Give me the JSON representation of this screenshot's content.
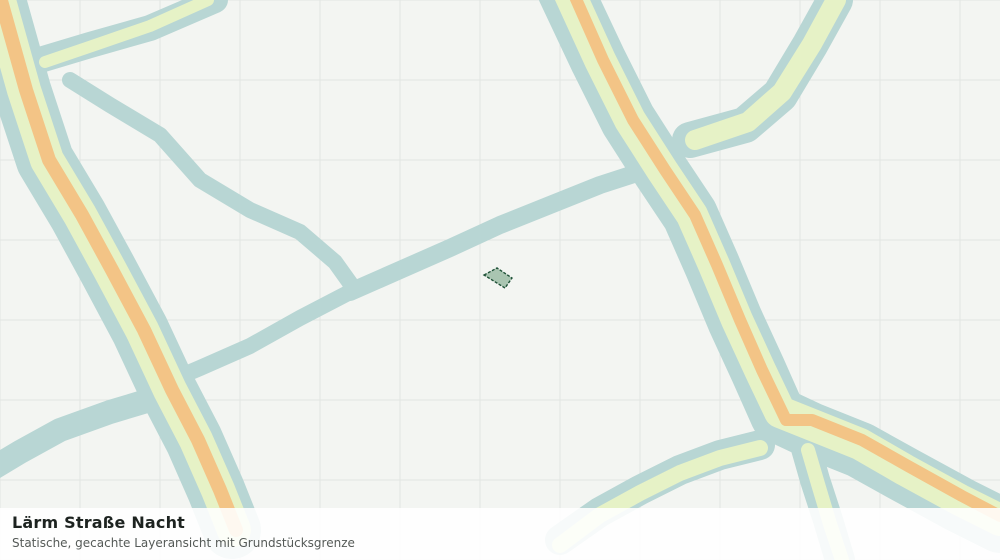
{
  "map": {
    "title": "Lärm Straße Nacht",
    "subtitle": "Statische, gecachte Layeransicht mit Grundstücksgrenze",
    "colors": {
      "background": "#f3f5f2",
      "grid": "#e1e5e2",
      "noise_outer": "#b8d6d4",
      "noise_middle": "#e6f2c6",
      "noise_inner": "#f3c486",
      "parcel_fill": "#a9c5b1",
      "parcel_stroke": "#1f5238"
    },
    "layers": [
      "grid",
      "noise-band-outer",
      "noise-band-middle",
      "noise-band-core",
      "parcel-boundary"
    ]
  }
}
